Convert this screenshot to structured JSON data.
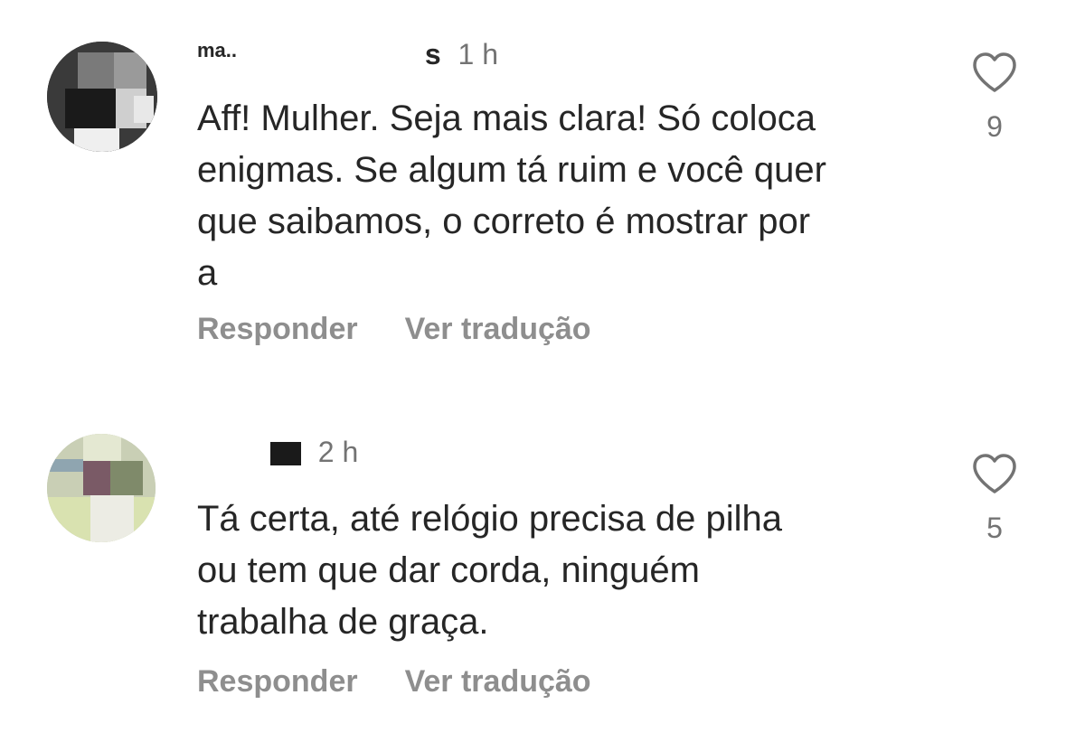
{
  "comments": [
    {
      "username": "ma..",
      "username_tail": "s",
      "time": "1 h",
      "text": "Aff! Mulher. Seja mais clara! Só coloca\nenigmas. Se algum tá ruim e você quer\nque saibamos, o correto é mostrar por\na",
      "reply_label": "Responder",
      "translate_label": "Ver tradução",
      "like_count": "9"
    },
    {
      "username": "",
      "time": "2 h",
      "text": "Tá certa, até relógio precisa de pilha\nou tem que dar corda, ninguém\ntrabalha de graça.",
      "reply_label": "Responder",
      "translate_label": "Ver tradução",
      "like_count": "5"
    }
  ],
  "colors": {
    "primary_text": "#262626",
    "secondary_text": "#737373",
    "action_text": "#8e8e8e",
    "background": "#ffffff"
  },
  "icons": {
    "like": "heart-outline-icon"
  }
}
